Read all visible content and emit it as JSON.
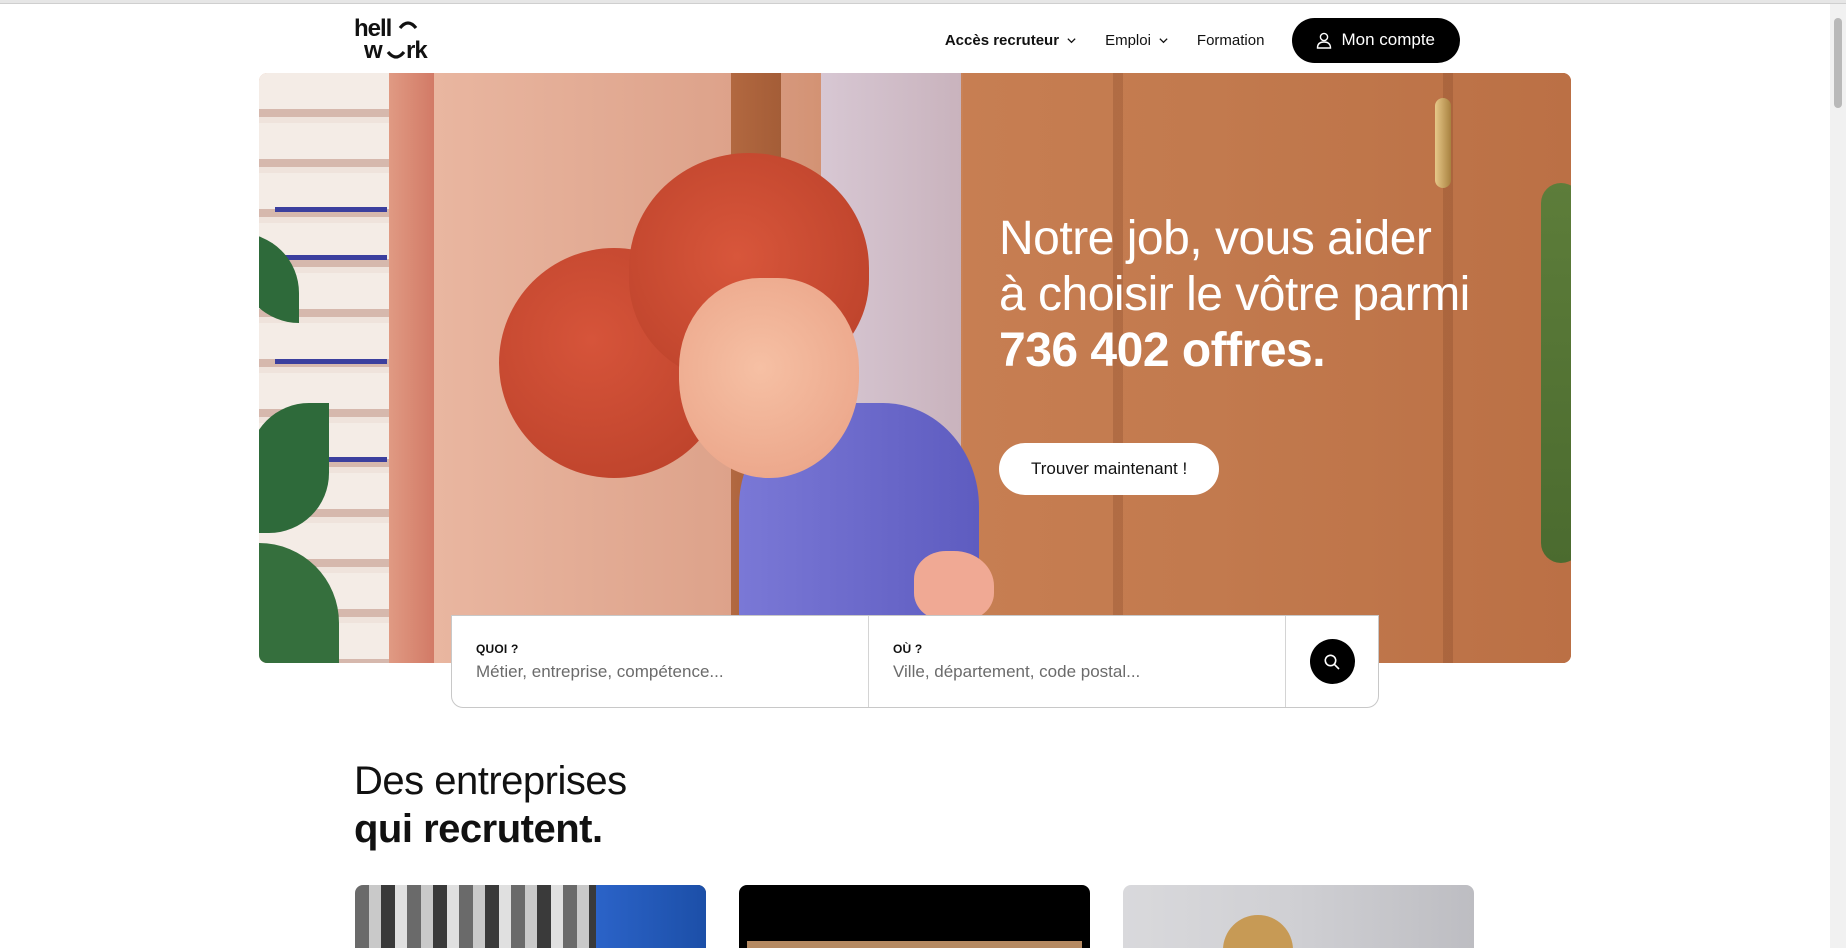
{
  "header": {
    "logo_text": "hellowork",
    "nav": [
      {
        "label": "Accès recruteur",
        "has_dropdown": true
      },
      {
        "label": "Emploi",
        "has_dropdown": true
      },
      {
        "label": "Formation",
        "has_dropdown": false
      }
    ],
    "account_label": "Mon compte"
  },
  "hero": {
    "line1": "Notre job, vous aider",
    "line2": "à choisir le vôtre parmi",
    "offers": "736 402 offres.",
    "cta_label": "Trouver maintenant !"
  },
  "search": {
    "what_label": "QUOI ?",
    "what_placeholder": "Métier, entreprise, compétence...",
    "where_label": "OÙ ?",
    "where_placeholder": "Ville, département, code postal..."
  },
  "section": {
    "title_line1": "Des entreprises",
    "title_line2": "qui recrutent."
  },
  "colors": {
    "primary_button": "#000000",
    "hero_text": "#ffffff"
  }
}
